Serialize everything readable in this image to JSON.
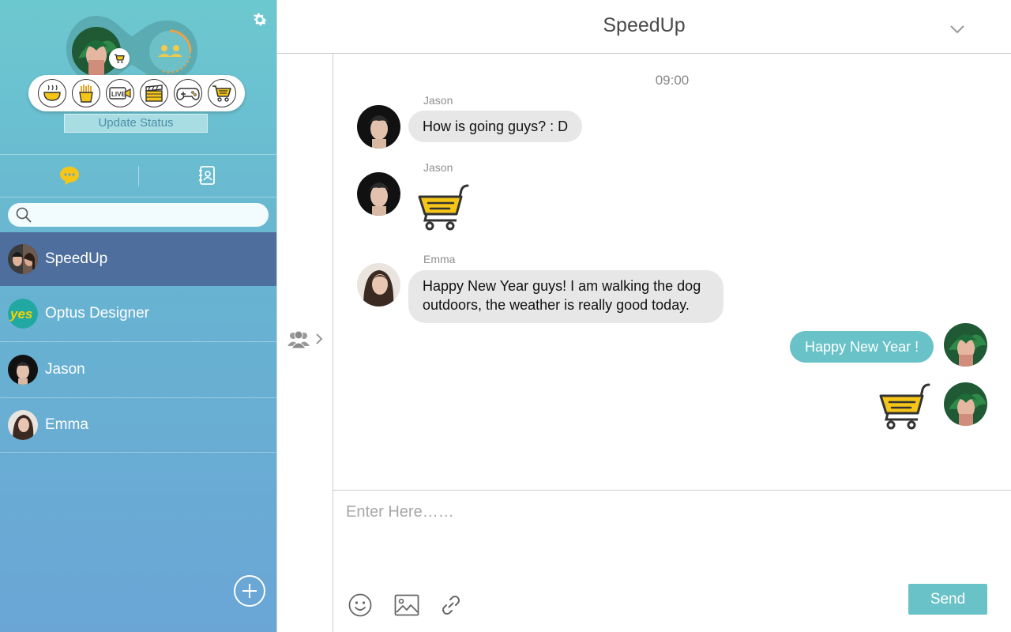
{
  "profile": {
    "update_status_label": "Update Status",
    "status_badge_icon": "cart-icon"
  },
  "status_options": [
    "coffee-icon",
    "fries-icon",
    "live-video-icon",
    "clapperboard-icon",
    "gamepad-icon",
    "cart-icon"
  ],
  "status_live_text": "LIVE",
  "tabs": [
    "chat-bubble-icon",
    "contacts-book-icon"
  ],
  "search": {
    "placeholder": "",
    "value": ""
  },
  "contacts": [
    {
      "name": "SpeedUp",
      "active": true
    },
    {
      "name": "Optus Designer",
      "avatar_text": "yes",
      "active": false
    },
    {
      "name": "Jason",
      "active": false
    },
    {
      "name": "Emma",
      "active": false
    }
  ],
  "chat": {
    "title": "SpeedUp",
    "time": "09:00",
    "messages": [
      {
        "sender": "Jason",
        "text": "How is going guys? : D"
      },
      {
        "sender": "Jason",
        "sticker": "cart-icon"
      },
      {
        "sender": "Emma",
        "text_line1": "Happy New Year guys! I am walking the dog",
        "text_line2": "outdoors, the weather is really good today."
      },
      {
        "sender": "me",
        "text": "Happy New Year !"
      },
      {
        "sender": "me",
        "sticker": "cart-icon"
      }
    ]
  },
  "composer": {
    "placeholder": "Enter Here……",
    "value": "",
    "send_label": "Send"
  },
  "colors": {
    "accent": "#69c2c7",
    "active_contact": "#4e6f9d",
    "sticker_yellow": "#f5c518"
  }
}
